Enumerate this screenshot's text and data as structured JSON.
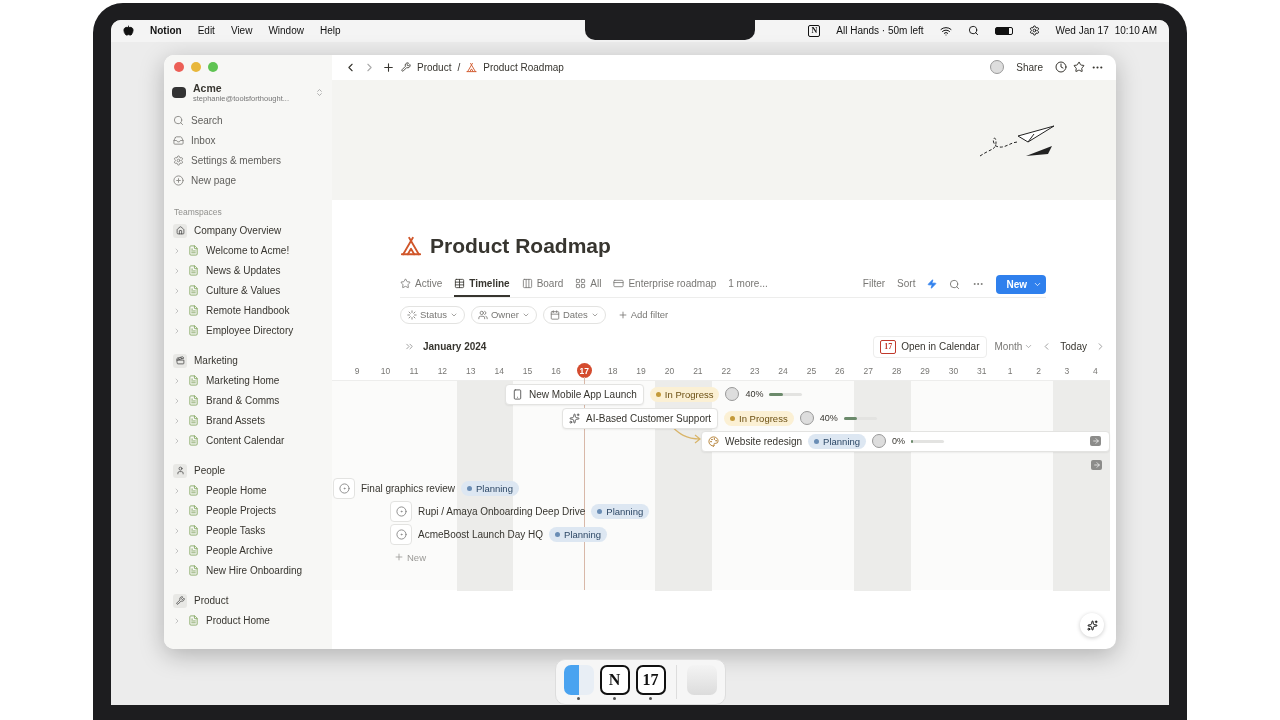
{
  "menu_bar": {
    "app": "Notion",
    "menus": [
      "Edit",
      "View",
      "Window",
      "Help"
    ],
    "status_glyph": "N",
    "meeting": "All Hands · 50m left",
    "date": "Wed Jan 17",
    "time": "10:10 AM"
  },
  "sidebar": {
    "workspace": {
      "name": "Acme",
      "email": "stephanie@toolsforthought..."
    },
    "actions": [
      "Search",
      "Inbox",
      "Settings & members",
      "New page"
    ],
    "heading": "Teamspaces",
    "teamspaces": [
      {
        "name": "Company Overview",
        "children": [
          {
            "name": "Welcome to Acme!"
          },
          {
            "name": "News & Updates"
          },
          {
            "name": "Culture & Values"
          },
          {
            "name": "Remote Handbook"
          },
          {
            "name": "Employee Directory"
          }
        ]
      },
      {
        "name": "Marketing",
        "children": [
          {
            "name": "Marketing Home"
          },
          {
            "name": "Brand & Comms"
          },
          {
            "name": "Brand Assets"
          },
          {
            "name": "Content Calendar"
          }
        ]
      },
      {
        "name": "People",
        "children": [
          {
            "name": "People Home"
          },
          {
            "name": "People Projects"
          },
          {
            "name": "People Tasks"
          },
          {
            "name": "People Archive"
          },
          {
            "name": "New Hire Onboarding"
          }
        ]
      },
      {
        "name": "Product",
        "children": [
          {
            "name": "Product Home"
          }
        ]
      }
    ]
  },
  "topbar": {
    "parent": "Product",
    "separator": "/",
    "current": "Product Roadmap",
    "share": "Share"
  },
  "page": {
    "title": "Product Roadmap",
    "views": [
      {
        "label": "Active",
        "selected": false
      },
      {
        "label": "Timeline",
        "selected": true
      },
      {
        "label": "Board",
        "selected": false
      },
      {
        "label": "All",
        "selected": false
      },
      {
        "label": "Enterprise roadmap",
        "selected": false
      }
    ],
    "more_views": "1 more...",
    "actions": [
      "Filter",
      "Sort"
    ],
    "new_button": "New",
    "filters": [
      "Status",
      "Owner",
      "Dates"
    ],
    "add_filter": "Add filter"
  },
  "timeline": {
    "month": "January 2024",
    "open_calendar": "Open in Calendar",
    "calendar_glyph": "17",
    "scale": "Month",
    "today": "Today",
    "days": [
      {
        "label": "9",
        "today": false,
        "weekend": false
      },
      {
        "label": "10",
        "today": false,
        "weekend": false
      },
      {
        "label": "11",
        "today": false,
        "weekend": false
      },
      {
        "label": "12",
        "today": false,
        "weekend": false
      },
      {
        "label": "13",
        "today": false,
        "weekend": true
      },
      {
        "label": "14",
        "today": false,
        "weekend": true
      },
      {
        "label": "15",
        "today": false,
        "weekend": false
      },
      {
        "label": "16",
        "today": false,
        "weekend": false
      },
      {
        "label": "17",
        "today": true,
        "weekend": false
      },
      {
        "label": "18",
        "today": false,
        "weekend": false
      },
      {
        "label": "19",
        "today": false,
        "weekend": false
      },
      {
        "label": "20",
        "today": false,
        "weekend": true
      },
      {
        "label": "21",
        "today": false,
        "weekend": true
      },
      {
        "label": "22",
        "today": false,
        "weekend": false
      },
      {
        "label": "23",
        "today": false,
        "weekend": false
      },
      {
        "label": "24",
        "today": false,
        "weekend": false
      },
      {
        "label": "25",
        "today": false,
        "weekend": false
      },
      {
        "label": "26",
        "today": false,
        "weekend": false
      },
      {
        "label": "27",
        "today": false,
        "weekend": true
      },
      {
        "label": "28",
        "today": false,
        "weekend": true
      },
      {
        "label": "29",
        "today": false,
        "weekend": false
      },
      {
        "label": "30",
        "today": false,
        "weekend": false
      },
      {
        "label": "31",
        "today": false,
        "weekend": false
      },
      {
        "label": "1",
        "today": false,
        "weekend": false
      },
      {
        "label": "2",
        "today": false,
        "weekend": false
      },
      {
        "label": "3",
        "today": false,
        "weekend": true
      },
      {
        "label": "4",
        "today": false,
        "weekend": true
      }
    ],
    "items": [
      {
        "kind": "card",
        "name": "New Mobile App Launch",
        "status": {
          "label": "In Progress",
          "kind": "in_progress"
        },
        "owner": true,
        "progress": {
          "text": "40%",
          "level": 0.4
        }
      },
      {
        "kind": "card",
        "name": "AI-Based Customer Support",
        "status": {
          "label": "In Progress",
          "kind": "in_progress"
        },
        "owner": true,
        "progress": {
          "text": "40%",
          "level": 0.4
        }
      },
      {
        "kind": "card",
        "name": "Website redesign",
        "status": {
          "label": "Planning",
          "kind": "planning"
        },
        "owner": true,
        "progress": {
          "text": "0%",
          "level": 0
        }
      },
      {
        "kind": "pin",
        "name": "Final graphics review",
        "status": {
          "label": "Planning",
          "kind": "planning"
        },
        "owner": false
      },
      {
        "kind": "pin",
        "name": "Rupi / Amaya Onboarding Deep Drive",
        "status": {
          "label": "Planning",
          "kind": "planning"
        },
        "owner": false
      },
      {
        "kind": "pin",
        "name": "AcmeBoost Launch Day HQ",
        "status": {
          "label": "Planning",
          "kind": "planning"
        },
        "owner": false
      }
    ],
    "new": "New"
  },
  "dock": [
    {
      "kind": "finder",
      "running": true
    },
    {
      "kind": "notion",
      "glyph": "N",
      "running": true
    },
    {
      "kind": "calendar",
      "glyph": "17",
      "running": true
    },
    {
      "kind": "trash",
      "running": false
    }
  ]
}
